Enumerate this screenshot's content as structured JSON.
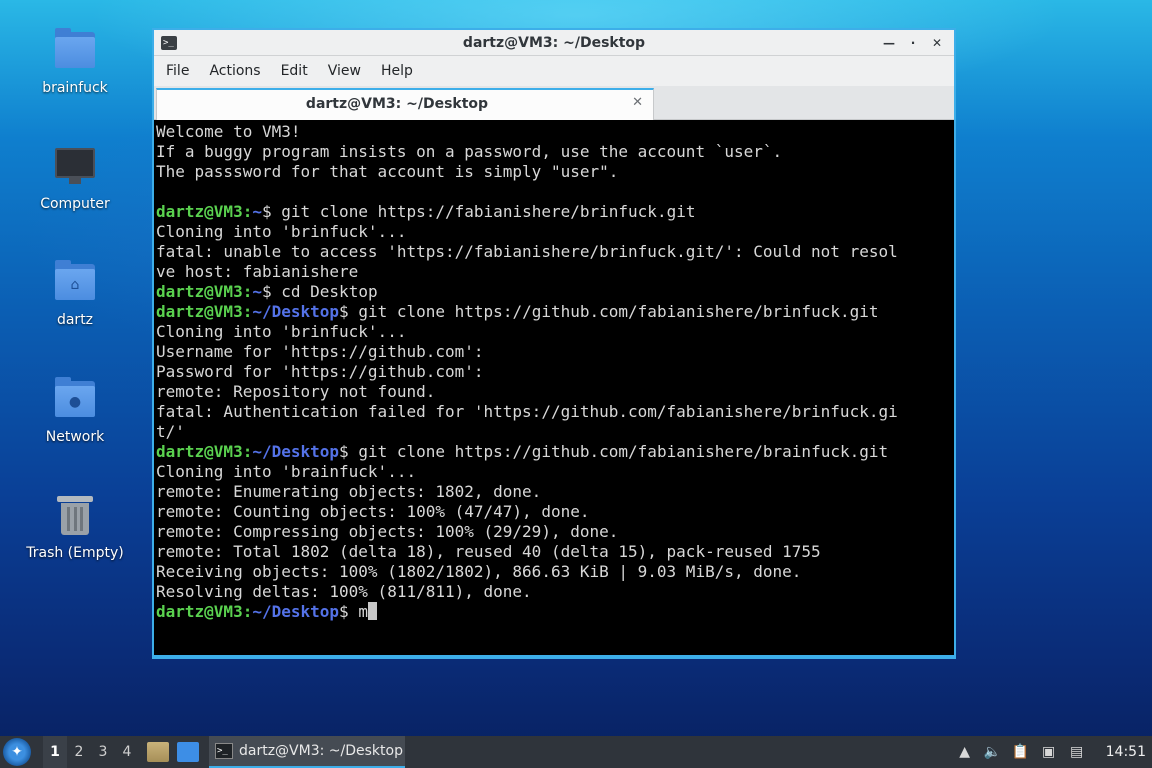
{
  "desktop": {
    "icons": [
      {
        "label": "brainfuck",
        "icon": "folder-icon"
      },
      {
        "label": "Computer",
        "icon": "computer-icon"
      },
      {
        "label": "dartz",
        "icon": "home-folder-icon"
      },
      {
        "label": "Network",
        "icon": "network-folder-icon"
      },
      {
        "label": "Trash (Empty)",
        "icon": "trash-icon"
      }
    ]
  },
  "window": {
    "title": "dartz@VM3: ~/Desktop",
    "controls": {
      "minimize": "—",
      "maximize": "·",
      "close": "✕"
    },
    "menu": [
      "File",
      "Actions",
      "Edit",
      "View",
      "Help"
    ],
    "tab": {
      "label": "dartz@VM3: ~/Desktop",
      "close": "✕"
    }
  },
  "terminal": {
    "prompt_user": "dartz@VM3",
    "lines": [
      {
        "text": "Welcome to VM3!"
      },
      {
        "text": "If a buggy program insists on a password, use the account `user`."
      },
      {
        "text": "The passsword for that account is simply \"user\"."
      },
      {
        "text": ""
      },
      {
        "path": "~",
        "cmd": " git clone https://fabianishere/brinfuck.git"
      },
      {
        "text": "Cloning into 'brinfuck'..."
      },
      {
        "text": "fatal: unable to access 'https://fabianishere/brinfuck.git/': Could not resol"
      },
      {
        "text": "ve host: fabianishere"
      },
      {
        "path": "~",
        "cmd": " cd Desktop"
      },
      {
        "path": "~/Desktop",
        "cmd": " git clone https://github.com/fabianishere/brinfuck.git"
      },
      {
        "text": "Cloning into 'brinfuck'..."
      },
      {
        "text": "Username for 'https://github.com':"
      },
      {
        "text": "Password for 'https://github.com':"
      },
      {
        "text": "remote: Repository not found."
      },
      {
        "text": "fatal: Authentication failed for 'https://github.com/fabianishere/brinfuck.gi"
      },
      {
        "text": "t/'"
      },
      {
        "path": "~/Desktop",
        "cmd": " git clone https://github.com/fabianishere/brainfuck.git"
      },
      {
        "text": "Cloning into 'brainfuck'..."
      },
      {
        "text": "remote: Enumerating objects: 1802, done."
      },
      {
        "text": "remote: Counting objects: 100% (47/47), done."
      },
      {
        "text": "remote: Compressing objects: 100% (29/29), done."
      },
      {
        "text": "remote: Total 1802 (delta 18), reused 40 (delta 15), pack-reused 1755"
      },
      {
        "text": "Receiving objects: 100% (1802/1802), 866.63 KiB | 9.03 MiB/s, done."
      },
      {
        "text": "Resolving deltas: 100% (811/811), done."
      },
      {
        "path": "~/Desktop",
        "cmd": " m",
        "cursor": true
      }
    ]
  },
  "taskbar": {
    "workspaces": [
      "1",
      "2",
      "3",
      "4"
    ],
    "active_workspace": "1",
    "task_label": "dartz@VM3: ~/Desktop",
    "clock": "14:51"
  }
}
